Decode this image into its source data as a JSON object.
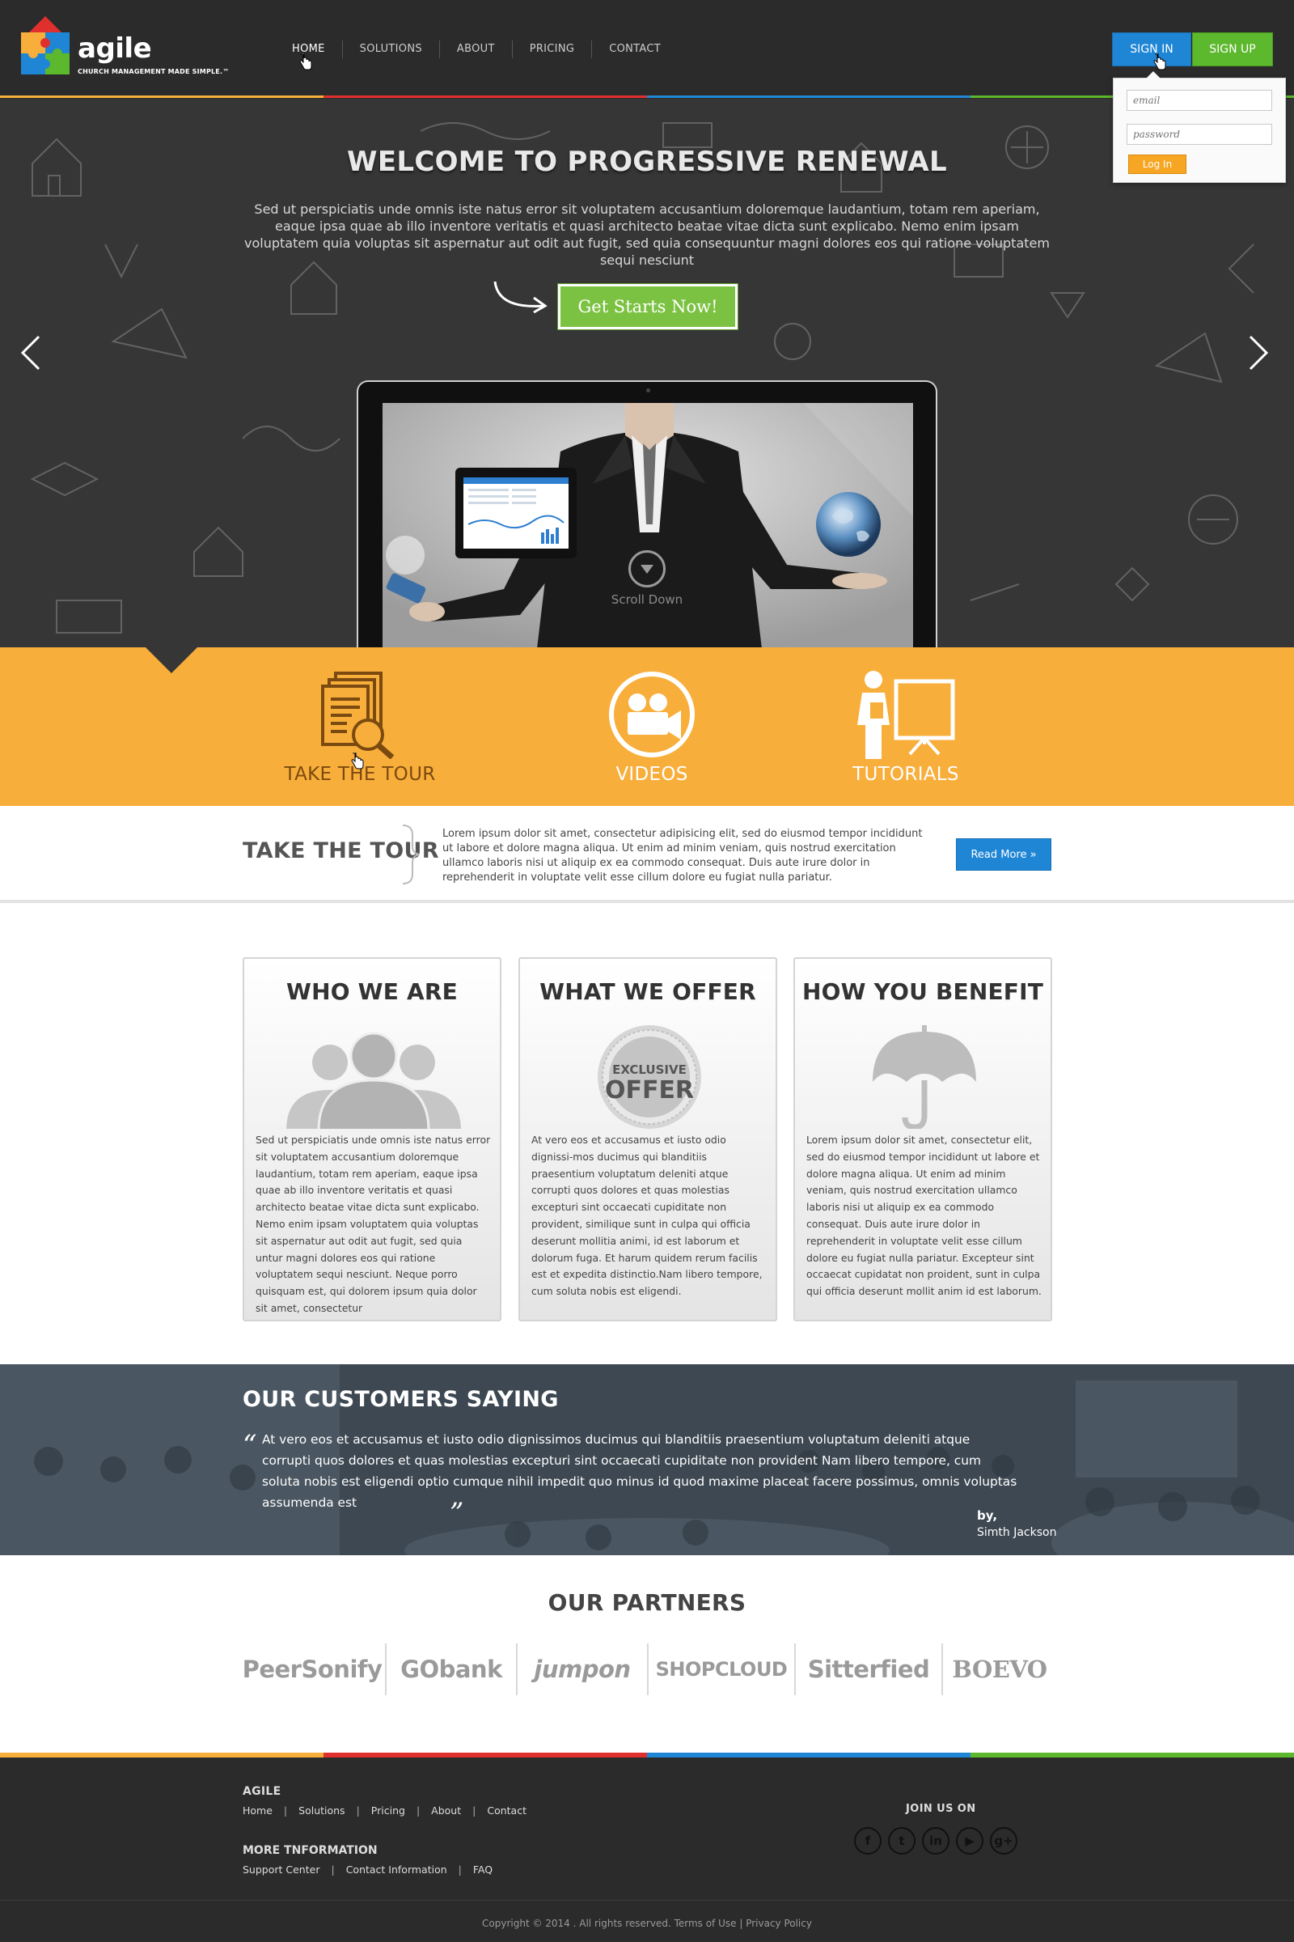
{
  "header": {
    "logo_word": "agile",
    "logo_tagline": "CHURCH MANAGEMENT MADE SIMPLE.™",
    "nav": [
      "HOME",
      "SOLUTIONS",
      "ABOUT",
      "PRICING",
      "CONTACT"
    ],
    "sign_in": "SIGN IN",
    "sign_up": "SIGN UP",
    "colors": {
      "blue": "#1f86d5",
      "green": "#5cb82d",
      "orange": "#f6a623",
      "red": "#e0302d"
    }
  },
  "login": {
    "email_placeholder": "email",
    "password_placeholder": "password",
    "button": "Log In"
  },
  "hero": {
    "title": "WELCOME TO PROGRESSIVE RENEWAL",
    "text": "Sed ut perspiciatis unde omnis iste natus error sit voluptatem accusantium doloremque laudantium, totam rem aperiam, eaque ipsa quae ab illo inventore veritatis et quasi architecto beatae vitae dicta sunt explicabo. Nemo enim ipsam voluptatem quia voluptas sit aspernatur aut odit aut fugit, sed quia consequuntur magni dolores eos qui ratione voluptatem sequi nesciunt",
    "cta": "Get Starts Now!",
    "scroll_label": "Scroll Down"
  },
  "features": {
    "color": "#f8ae3a",
    "items": [
      {
        "label": "TAKE THE TOUR",
        "icon": "document-search-icon"
      },
      {
        "label": "VIDEOS",
        "icon": "video-camera-icon"
      },
      {
        "label": "TUTORIALS",
        "icon": "presentation-board-icon"
      }
    ]
  },
  "tour": {
    "title": "TAKE THE TOUR",
    "text": "Lorem ipsum dolor sit amet, consectetur adipisicing elit, sed do eiusmod tempor incididunt ut labore et dolore magna aliqua. Ut enim ad minim veniam, quis nostrud exercitation ullamco laboris nisi ut aliquip ex ea commodo consequat. Duis aute irure dolor in reprehenderit in voluptate velit esse cillum dolore eu fugiat nulla pariatur.",
    "read_more": "Read More »"
  },
  "cards": [
    {
      "title": "WHO WE ARE",
      "icon": "people-group-icon",
      "text": "Sed ut perspiciatis unde omnis iste natus error sit voluptatem accusantium doloremque laudantium, totam rem aperiam, eaque ipsa quae ab illo inventore veritatis et quasi architecto beatae vitae dicta sunt explicabo. Nemo enim ipsam voluptatem quia voluptas sit aspernatur aut odit aut fugit, sed quia untur magni dolores eos qui ratione voluptatem sequi nesciunt. Neque porro quisquam est, qui dolorem ipsum quia dolor sit amet, consectetur"
    },
    {
      "title": "WHAT WE OFFER",
      "icon": "exclusive-offer-badge-icon",
      "badge_line1": "EXCLUSIVE",
      "badge_line2": "OFFER",
      "text": "At vero eos et accusamus et iusto odio dignissi-mos ducimus qui blanditiis praesentium voluptatum deleniti atque corrupti quos dolores et quas molestias excepturi sint occaecati cupiditate non provident, similique sunt in culpa qui officia deserunt mollitia animi, id est laborum et dolorum fuga. Et harum quidem rerum facilis est et expedita distinctio.Nam libero tempore, cum soluta nobis est eligendi."
    },
    {
      "title": "HOW YOU BENEFIT",
      "icon": "umbrella-icon",
      "text": "Lorem ipsum dolor sit amet, consectetur elit, sed do eiusmod tempor incididunt ut labore et dolore magna aliqua. Ut enim ad minim veniam, quis nostrud exercitation ullamco laboris nisi ut aliquip ex ea commodo consequat. Duis aute irure dolor in reprehenderit in voluptate velit esse cillum dolore eu fugiat nulla pariatur. Excepteur sint occaecat cupidatat non proident, sunt in culpa qui officia deserunt mollit anim id est laborum."
    }
  ],
  "customers": {
    "title": "OUR CUSTOMERS SAYING",
    "quote": "At vero eos et accusamus et iusto odio dignissimos ducimus qui blanditiis praesentium voluptatum deleniti atque corrupti quos dolores et quas molestias excepturi sint occaecati cupiditate non provident Nam libero tempore, cum soluta nobis est eligendi optio cumque nihil impedit quo minus id quod maxime placeat facere possimus, omnis voluptas assumenda est",
    "quote_open": "“",
    "quote_close": "”",
    "by": "by,",
    "name": "Simth Jackson"
  },
  "partners": {
    "title": "OUR PARTNERS",
    "items": [
      "PeerSonify",
      "GObank",
      "jumpon",
      "SHOPCLOUD",
      "Sitterfied",
      "BOEVO"
    ]
  },
  "footer": {
    "color_bar": [
      "#f8ae3a",
      "#e0302d",
      "#1f86d5",
      "#5cb82d"
    ],
    "agile_heading": "AGILE",
    "links_1": [
      "Home",
      "Solutions",
      "Pricing",
      "About",
      "Contact"
    ],
    "more_heading": "MORE TNFORMATION",
    "links_2": [
      "Support Center",
      "Contact Information",
      "FAQ"
    ],
    "join_heading": "JOIN US ON",
    "social": [
      {
        "glyph": "f",
        "icon": "facebook-icon"
      },
      {
        "glyph": "t",
        "icon": "twitter-icon"
      },
      {
        "glyph": "in",
        "icon": "linkedin-icon"
      },
      {
        "glyph": "▶",
        "icon": "youtube-icon"
      },
      {
        "glyph": "g+",
        "icon": "google-plus-icon"
      }
    ],
    "copyright": "Copyright © 2014 . All rights reserved. Terms of Use | Privacy Policy"
  }
}
